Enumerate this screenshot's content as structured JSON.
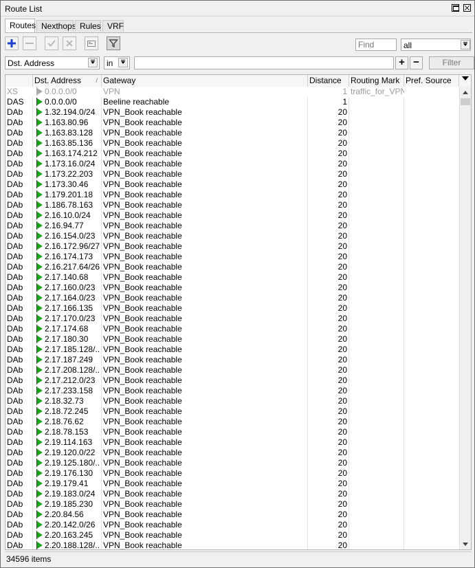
{
  "window": {
    "title": "Route List"
  },
  "tabs": [
    {
      "label": "Routes",
      "active": true
    },
    {
      "label": "Nexthops",
      "active": false
    },
    {
      "label": "Rules",
      "active": false
    },
    {
      "label": "VRF",
      "active": false
    }
  ],
  "toolbar": {
    "find_placeholder": "Find",
    "scope_value": "all"
  },
  "filter": {
    "field": "Dst. Address",
    "operator": "in",
    "value": "",
    "add_label": "+",
    "remove_label": "−",
    "filter_label": "Filter"
  },
  "columns": {
    "flags": "",
    "dst": "Dst. Address",
    "gateway": "Gateway",
    "distance": "Distance",
    "mark": "Routing Mark",
    "source": "Pref. Source"
  },
  "rows": [
    {
      "flags": "XS",
      "dst": "0.0.0.0/0",
      "gateway": "VPN",
      "distance": "1",
      "mark": "traffic_for_VPN",
      "source": "",
      "disabled": true
    },
    {
      "flags": "DAS",
      "dst": "0.0.0.0/0",
      "gateway": "Beeline reachable",
      "distance": "1",
      "mark": "",
      "source": ""
    },
    {
      "flags": "DAb",
      "dst": "1.32.194.0/24",
      "gateway": "VPN_Book reachable",
      "distance": "20",
      "mark": "",
      "source": ""
    },
    {
      "flags": "DAb",
      "dst": "1.163.80.96",
      "gateway": "VPN_Book reachable",
      "distance": "20",
      "mark": "",
      "source": ""
    },
    {
      "flags": "DAb",
      "dst": "1.163.83.128",
      "gateway": "VPN_Book reachable",
      "distance": "20",
      "mark": "",
      "source": ""
    },
    {
      "flags": "DAb",
      "dst": "1.163.85.136",
      "gateway": "VPN_Book reachable",
      "distance": "20",
      "mark": "",
      "source": ""
    },
    {
      "flags": "DAb",
      "dst": "1.163.174.212",
      "gateway": "VPN_Book reachable",
      "distance": "20",
      "mark": "",
      "source": ""
    },
    {
      "flags": "DAb",
      "dst": "1.173.16.0/24",
      "gateway": "VPN_Book reachable",
      "distance": "20",
      "mark": "",
      "source": ""
    },
    {
      "flags": "DAb",
      "dst": "1.173.22.203",
      "gateway": "VPN_Book reachable",
      "distance": "20",
      "mark": "",
      "source": ""
    },
    {
      "flags": "DAb",
      "dst": "1.173.30.46",
      "gateway": "VPN_Book reachable",
      "distance": "20",
      "mark": "",
      "source": ""
    },
    {
      "flags": "DAb",
      "dst": "1.179.201.18",
      "gateway": "VPN_Book reachable",
      "distance": "20",
      "mark": "",
      "source": ""
    },
    {
      "flags": "DAb",
      "dst": "1.186.78.163",
      "gateway": "VPN_Book reachable",
      "distance": "20",
      "mark": "",
      "source": ""
    },
    {
      "flags": "DAb",
      "dst": "2.16.10.0/24",
      "gateway": "VPN_Book reachable",
      "distance": "20",
      "mark": "",
      "source": ""
    },
    {
      "flags": "DAb",
      "dst": "2.16.94.77",
      "gateway": "VPN_Book reachable",
      "distance": "20",
      "mark": "",
      "source": ""
    },
    {
      "flags": "DAb",
      "dst": "2.16.154.0/23",
      "gateway": "VPN_Book reachable",
      "distance": "20",
      "mark": "",
      "source": ""
    },
    {
      "flags": "DAb",
      "dst": "2.16.172.96/27",
      "gateway": "VPN_Book reachable",
      "distance": "20",
      "mark": "",
      "source": ""
    },
    {
      "flags": "DAb",
      "dst": "2.16.174.173",
      "gateway": "VPN_Book reachable",
      "distance": "20",
      "mark": "",
      "source": ""
    },
    {
      "flags": "DAb",
      "dst": "2.16.217.64/26",
      "gateway": "VPN_Book reachable",
      "distance": "20",
      "mark": "",
      "source": ""
    },
    {
      "flags": "DAb",
      "dst": "2.17.140.68",
      "gateway": "VPN_Book reachable",
      "distance": "20",
      "mark": "",
      "source": ""
    },
    {
      "flags": "DAb",
      "dst": "2.17.160.0/23",
      "gateway": "VPN_Book reachable",
      "distance": "20",
      "mark": "",
      "source": ""
    },
    {
      "flags": "DAb",
      "dst": "2.17.164.0/23",
      "gateway": "VPN_Book reachable",
      "distance": "20",
      "mark": "",
      "source": ""
    },
    {
      "flags": "DAb",
      "dst": "2.17.166.135",
      "gateway": "VPN_Book reachable",
      "distance": "20",
      "mark": "",
      "source": ""
    },
    {
      "flags": "DAb",
      "dst": "2.17.170.0/23",
      "gateway": "VPN_Book reachable",
      "distance": "20",
      "mark": "",
      "source": ""
    },
    {
      "flags": "DAb",
      "dst": "2.17.174.68",
      "gateway": "VPN_Book reachable",
      "distance": "20",
      "mark": "",
      "source": ""
    },
    {
      "flags": "DAb",
      "dst": "2.17.180.30",
      "gateway": "VPN_Book reachable",
      "distance": "20",
      "mark": "",
      "source": ""
    },
    {
      "flags": "DAb",
      "dst": "2.17.185.128/...",
      "gateway": "VPN_Book reachable",
      "distance": "20",
      "mark": "",
      "source": ""
    },
    {
      "flags": "DAb",
      "dst": "2.17.187.249",
      "gateway": "VPN_Book reachable",
      "distance": "20",
      "mark": "",
      "source": ""
    },
    {
      "flags": "DAb",
      "dst": "2.17.208.128/...",
      "gateway": "VPN_Book reachable",
      "distance": "20",
      "mark": "",
      "source": ""
    },
    {
      "flags": "DAb",
      "dst": "2.17.212.0/23",
      "gateway": "VPN_Book reachable",
      "distance": "20",
      "mark": "",
      "source": ""
    },
    {
      "flags": "DAb",
      "dst": "2.17.233.158",
      "gateway": "VPN_Book reachable",
      "distance": "20",
      "mark": "",
      "source": ""
    },
    {
      "flags": "DAb",
      "dst": "2.18.32.73",
      "gateway": "VPN_Book reachable",
      "distance": "20",
      "mark": "",
      "source": ""
    },
    {
      "flags": "DAb",
      "dst": "2.18.72.245",
      "gateway": "VPN_Book reachable",
      "distance": "20",
      "mark": "",
      "source": ""
    },
    {
      "flags": "DAb",
      "dst": "2.18.76.62",
      "gateway": "VPN_Book reachable",
      "distance": "20",
      "mark": "",
      "source": ""
    },
    {
      "flags": "DAb",
      "dst": "2.18.78.153",
      "gateway": "VPN_Book reachable",
      "distance": "20",
      "mark": "",
      "source": ""
    },
    {
      "flags": "DAb",
      "dst": "2.19.114.163",
      "gateway": "VPN_Book reachable",
      "distance": "20",
      "mark": "",
      "source": ""
    },
    {
      "flags": "DAb",
      "dst": "2.19.120.0/22",
      "gateway": "VPN_Book reachable",
      "distance": "20",
      "mark": "",
      "source": ""
    },
    {
      "flags": "DAb",
      "dst": "2.19.125.180/...",
      "gateway": "VPN_Book reachable",
      "distance": "20",
      "mark": "",
      "source": ""
    },
    {
      "flags": "DAb",
      "dst": "2.19.176.130",
      "gateway": "VPN_Book reachable",
      "distance": "20",
      "mark": "",
      "source": ""
    },
    {
      "flags": "DAb",
      "dst": "2.19.179.41",
      "gateway": "VPN_Book reachable",
      "distance": "20",
      "mark": "",
      "source": ""
    },
    {
      "flags": "DAb",
      "dst": "2.19.183.0/24",
      "gateway": "VPN_Book reachable",
      "distance": "20",
      "mark": "",
      "source": ""
    },
    {
      "flags": "DAb",
      "dst": "2.19.185.230",
      "gateway": "VPN_Book reachable",
      "distance": "20",
      "mark": "",
      "source": ""
    },
    {
      "flags": "DAb",
      "dst": "2.20.84.56",
      "gateway": "VPN_Book reachable",
      "distance": "20",
      "mark": "",
      "source": ""
    },
    {
      "flags": "DAb",
      "dst": "2.20.142.0/26",
      "gateway": "VPN_Book reachable",
      "distance": "20",
      "mark": "",
      "source": ""
    },
    {
      "flags": "DAb",
      "dst": "2.20.163.245",
      "gateway": "VPN_Book reachable",
      "distance": "20",
      "mark": "",
      "source": ""
    },
    {
      "flags": "DAb",
      "dst": "2.20.188.128/...",
      "gateway": "VPN_Book reachable",
      "distance": "20",
      "mark": "",
      "source": ""
    }
  ],
  "status": {
    "items": "34596 items"
  },
  "colors": {
    "flag_active": "#1aa51a",
    "flag_disabled": "#aaaaaa",
    "disabled_text": "#9a9a9a"
  },
  "icons": {
    "add": "plus-icon",
    "remove": "minus-icon",
    "enable": "check-icon",
    "disable": "x-icon",
    "comment": "note-icon",
    "filter": "funnel-icon",
    "route_flag": "flag-icon"
  }
}
